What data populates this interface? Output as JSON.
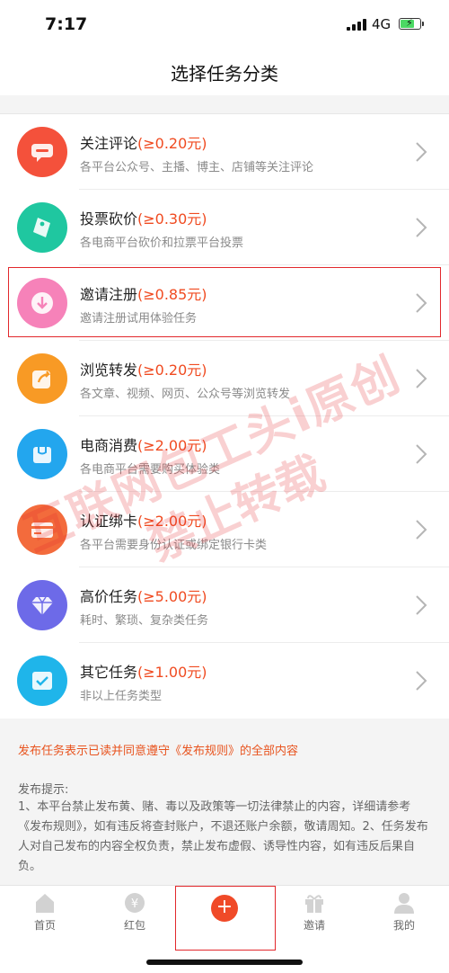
{
  "status_bar": {
    "time": "7:17",
    "network": "4G",
    "battery_level": 0.75
  },
  "nav": {
    "title": "选择任务分类"
  },
  "tasks": [
    {
      "name": "关注评论",
      "price": "(≥0.20元)",
      "desc": "各平台公众号、主播、博主、店铺等关注评论",
      "icon": "comment-icon",
      "color": "#f4513b"
    },
    {
      "name": "投票砍价",
      "price": "(≥0.30元)",
      "desc": "各电商平台砍价和拉票平台投票",
      "icon": "vote-tag-icon",
      "color": "#1fc7a0"
    },
    {
      "name": "邀请注册",
      "price": "(≥0.85元)",
      "desc": "邀请注册试用体验任务",
      "icon": "invite-download-icon",
      "color": "#f682b9"
    },
    {
      "name": "浏览转发",
      "price": "(≥0.20元)",
      "desc": "各文章、视频、网页、公众号等浏览转发",
      "icon": "share-icon",
      "color": "#f89a25"
    },
    {
      "name": "电商消费",
      "price": "(≥2.00元)",
      "desc": "各电商平台需要购买体验类",
      "icon": "shop-icon",
      "color": "#23a6ee"
    },
    {
      "name": "认证绑卡",
      "price": "(≥2.00元)",
      "desc": "各平台需要身份认证或绑定银行卡类",
      "icon": "bank-card-icon",
      "color": "#f36b3c"
    },
    {
      "name": "高价任务",
      "price": "(≥5.00元)",
      "desc": "耗时、繁琐、复杂类任务",
      "icon": "diamond-icon",
      "color": "#6d6ae8"
    },
    {
      "name": "其它任务",
      "price": "(≥1.00元)",
      "desc": "非以上任务类型",
      "icon": "checkbox-icon",
      "color": "#1fb5ea"
    }
  ],
  "notice": {
    "agree": "发布任务表示已读并同意遵守《发布规则》的全部内容",
    "heading": "发布提示:",
    "body": "1、本平台禁止发布黄、赌、毒以及政策等一切法律禁止的内容，详细请参考《发布规则》，如有违反将查封账户，不退还账户余额，敬请周知。2、任务发布人对自己发布的内容全权负责，禁止发布虚假、诱导性内容，如有违反后果自负。"
  },
  "watermark": {
    "line1": "互联网包工头i原创",
    "line2": "禁止转载"
  },
  "tabs": [
    {
      "label": "首页",
      "icon": "home-icon"
    },
    {
      "label": "红包",
      "icon": "red-packet-icon"
    },
    {
      "label": "",
      "icon": "plus-icon"
    },
    {
      "label": "邀请",
      "icon": "gift-icon"
    },
    {
      "label": "我的",
      "icon": "profile-icon"
    }
  ],
  "colors": {
    "accent": "#f04b21",
    "highlight": "#e2282c"
  }
}
